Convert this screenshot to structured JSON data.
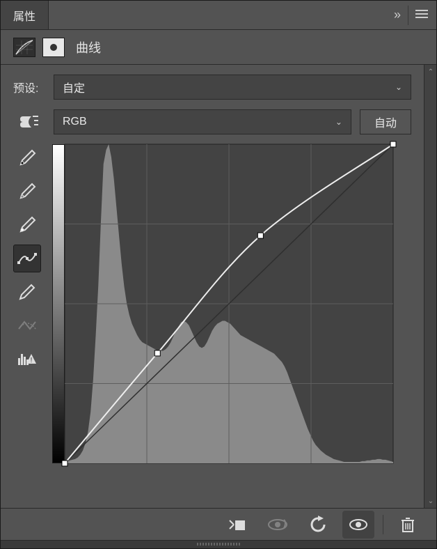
{
  "panel": {
    "title": "属性"
  },
  "header": {
    "adj_name": "曲线"
  },
  "preset": {
    "label": "预设:",
    "value": "自定"
  },
  "channel": {
    "value": "RGB",
    "auto_label": "自动"
  },
  "tools": [
    "eyedropper-black",
    "eyedropper-gray",
    "eyedropper-white",
    "curve-point",
    "pencil",
    "smooth",
    "histogram-warning"
  ],
  "footer_icons": [
    "clip-to-layer",
    "view-previous",
    "reset",
    "visibility",
    "delete"
  ],
  "chart_data": {
    "type": "curves",
    "x_range": [
      0,
      255
    ],
    "y_range": [
      0,
      255
    ],
    "grid_divisions": 4,
    "curve_points": [
      {
        "x": 0,
        "y": 0
      },
      {
        "x": 72,
        "y": 88
      },
      {
        "x": 152,
        "y": 182
      },
      {
        "x": 255,
        "y": 255
      }
    ],
    "baseline": [
      [
        0,
        0
      ],
      [
        255,
        255
      ]
    ],
    "histogram": [
      2,
      3,
      4,
      5,
      6,
      8,
      12,
      18,
      28,
      44,
      72,
      118,
      180,
      250,
      340,
      420,
      440,
      448,
      430,
      400,
      360,
      320,
      280,
      248,
      224,
      208,
      196,
      188,
      180,
      174,
      170,
      168,
      166,
      164,
      162,
      160,
      158,
      158,
      158,
      160,
      164,
      170,
      178,
      186,
      192,
      198,
      200,
      198,
      194,
      186,
      178,
      170,
      164,
      162,
      164,
      170,
      178,
      186,
      192,
      196,
      198,
      200,
      200,
      198,
      196,
      192,
      188,
      184,
      180,
      178,
      176,
      174,
      172,
      170,
      168,
      166,
      164,
      162,
      160,
      158,
      156,
      154,
      150,
      146,
      142,
      136,
      128,
      118,
      108,
      98,
      88,
      78,
      68,
      58,
      48,
      40,
      32,
      26,
      22,
      18,
      15,
      12,
      10,
      8,
      6,
      5,
      4,
      3,
      2,
      2,
      2,
      2,
      2,
      2,
      2,
      3,
      3,
      4,
      4,
      5,
      5,
      6,
      6,
      5,
      5,
      4,
      3,
      2
    ]
  }
}
